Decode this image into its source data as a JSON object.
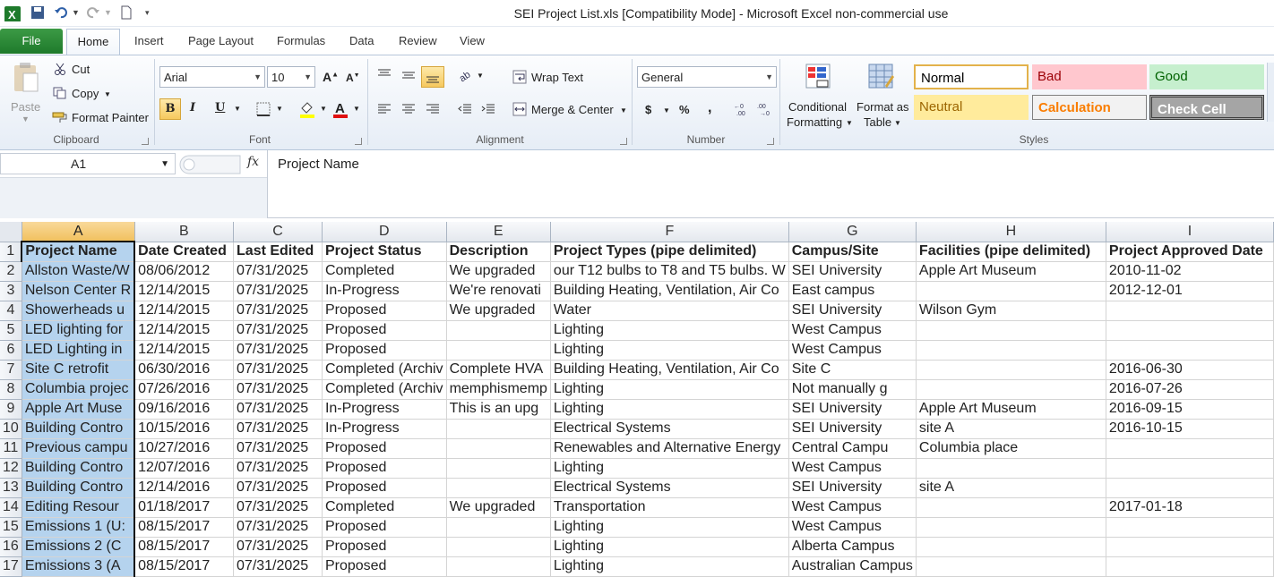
{
  "window": {
    "title": "SEI Project List.xls  [Compatibility Mode]  -  Microsoft Excel non-commercial use"
  },
  "tabs": {
    "file": "File",
    "home": "Home",
    "insert": "Insert",
    "page_layout": "Page Layout",
    "formulas": "Formulas",
    "data": "Data",
    "review": "Review",
    "view": "View"
  },
  "clipboard": {
    "paste": "Paste",
    "cut": "Cut",
    "copy": "Copy",
    "format_painter": "Format Painter",
    "label": "Clipboard"
  },
  "font": {
    "name": "Arial",
    "size": "10",
    "label": "Font",
    "bold": "B",
    "italic": "I",
    "underline": "U",
    "grow": "A",
    "shrink": "A"
  },
  "alignment": {
    "wrap_text": "Wrap Text",
    "merge_center": "Merge & Center",
    "label": "Alignment"
  },
  "number": {
    "format": "General",
    "currency": "$",
    "percent": "%",
    "comma": ",",
    "label": "Number"
  },
  "styles": {
    "conditional_formatting_1": "Conditional",
    "conditional_formatting_2": "Formatting",
    "format_as_table_1": "Format as",
    "format_as_table_2": "Table",
    "normal": "Normal",
    "bad": "Bad",
    "good": "Good",
    "neutral": "Neutral",
    "calculation": "Calculation",
    "check_cell": "Check Cell",
    "label": "Styles"
  },
  "formula_bar": {
    "name_box": "A1",
    "fx": "fx",
    "content": "Project Name"
  },
  "columns": [
    "A",
    "B",
    "C",
    "D",
    "E",
    "F",
    "G",
    "H",
    "I"
  ],
  "rows": [
    [
      "Project Name",
      "Date Created",
      "Last Edited",
      "Project Status",
      "Description",
      "Project Types (pipe delimited)",
      "Campus/Site",
      "Facilities (pipe delimited)",
      "Project Approved Date"
    ],
    [
      "Allston Waste/W",
      "08/06/2012",
      "07/31/2025",
      "Completed",
      "We upgraded",
      "our T12 bulbs to T8 and T5 bulbs. W",
      "SEI University",
      "Apple Art Museum",
      "2010-11-02"
    ],
    [
      "Nelson Center R",
      "12/14/2015",
      "07/31/2025",
      "In-Progress",
      "We're renovati",
      "Building Heating, Ventilation, Air Co",
      "East campus",
      "",
      "2012-12-01"
    ],
    [
      "Showerheads u",
      "12/14/2015",
      "07/31/2025",
      "Proposed",
      "We upgraded",
      "Water",
      "SEI University",
      "Wilson Gym",
      ""
    ],
    [
      "LED lighting for",
      "12/14/2015",
      "07/31/2025",
      "Proposed",
      "",
      "Lighting",
      "West Campus",
      "",
      ""
    ],
    [
      "LED Lighting in",
      "12/14/2015",
      "07/31/2025",
      "Proposed",
      "",
      "Lighting",
      "West Campus",
      "",
      ""
    ],
    [
      "Site C retrofit",
      "06/30/2016",
      "07/31/2025",
      "Completed (Archiv",
      "Complete HVA",
      "Building Heating, Ventilation, Air Co",
      "Site C",
      "",
      "2016-06-30"
    ],
    [
      "Columbia projec",
      "07/26/2016",
      "07/31/2025",
      "Completed (Archiv",
      "memphismemp",
      "Lighting",
      "Not manually g",
      "",
      "2016-07-26"
    ],
    [
      "Apple Art Muse",
      "09/16/2016",
      "07/31/2025",
      "In-Progress",
      "This is an upg",
      "Lighting",
      "SEI University",
      "Apple Art Museum",
      "2016-09-15"
    ],
    [
      "Building Contro",
      "10/15/2016",
      "07/31/2025",
      "In-Progress",
      "",
      "Electrical Systems",
      "SEI University",
      "site A",
      "2016-10-15"
    ],
    [
      "Previous campu",
      "10/27/2016",
      "07/31/2025",
      "Proposed",
      "",
      "Renewables and Alternative Energy",
      "Central Campu",
      "Columbia place",
      ""
    ],
    [
      "Building Contro",
      "12/07/2016",
      "07/31/2025",
      "Proposed",
      "",
      "Lighting",
      "West Campus",
      "",
      ""
    ],
    [
      "Building Contro",
      "12/14/2016",
      "07/31/2025",
      "Proposed",
      "",
      "Electrical Systems",
      "SEI University",
      "site A",
      ""
    ],
    [
      "Editing Resour",
      "01/18/2017",
      "07/31/2025",
      "Completed",
      "We upgraded",
      "Transportation",
      "West Campus",
      "",
      "2017-01-18"
    ],
    [
      "Emissions 1 (U:",
      "08/15/2017",
      "07/31/2025",
      "Proposed",
      "",
      "Lighting",
      "West Campus",
      "",
      ""
    ],
    [
      "Emissions 2 (C",
      "08/15/2017",
      "07/31/2025",
      "Proposed",
      "",
      "Lighting",
      "Alberta Campus",
      "",
      ""
    ],
    [
      "Emissions 3 (A",
      "08/15/2017",
      "07/31/2025",
      "Proposed",
      "",
      "Lighting",
      "Australian Campus",
      "",
      ""
    ]
  ]
}
